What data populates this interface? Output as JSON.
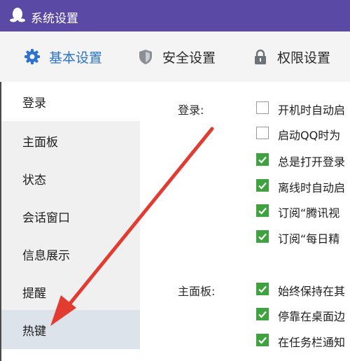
{
  "window": {
    "title": "系统设置"
  },
  "tabs": [
    {
      "label": "基本设置",
      "icon": "gear-icon",
      "active": true
    },
    {
      "label": "安全设置",
      "icon": "shield-icon",
      "active": false
    },
    {
      "label": "权限设置",
      "icon": "lock-icon",
      "active": false
    }
  ],
  "sidebar": {
    "items": [
      {
        "label": "登录"
      },
      {
        "label": "主面板"
      },
      {
        "label": "状态"
      },
      {
        "label": "会话窗口"
      },
      {
        "label": "信息展示"
      },
      {
        "label": "提醒"
      },
      {
        "label": "热键",
        "selected": true
      }
    ]
  },
  "sections": {
    "login": {
      "label": "登录:",
      "options": [
        {
          "label": "开机时自动启",
          "checked": false
        },
        {
          "label": "启动QQ时为",
          "checked": false
        },
        {
          "label": "总是打开登录",
          "checked": true
        },
        {
          "label": "离线时自动启",
          "checked": true
        },
        {
          "label": "订阅“腾讯视",
          "checked": true
        },
        {
          "label": "订阅“每日精",
          "checked": true
        }
      ]
    },
    "panel": {
      "label": "主面板:",
      "options": [
        {
          "label": "始终保持在其",
          "checked": true
        },
        {
          "label": "停靠在桌面边",
          "checked": true
        },
        {
          "label": "在任务栏通知",
          "checked": true
        }
      ]
    }
  },
  "colors": {
    "titlebar": "#5a4aa6",
    "accent": "#2b73cf",
    "checkbox_checked": "#3ea33e",
    "annotation_arrow": "#e23b30"
  }
}
